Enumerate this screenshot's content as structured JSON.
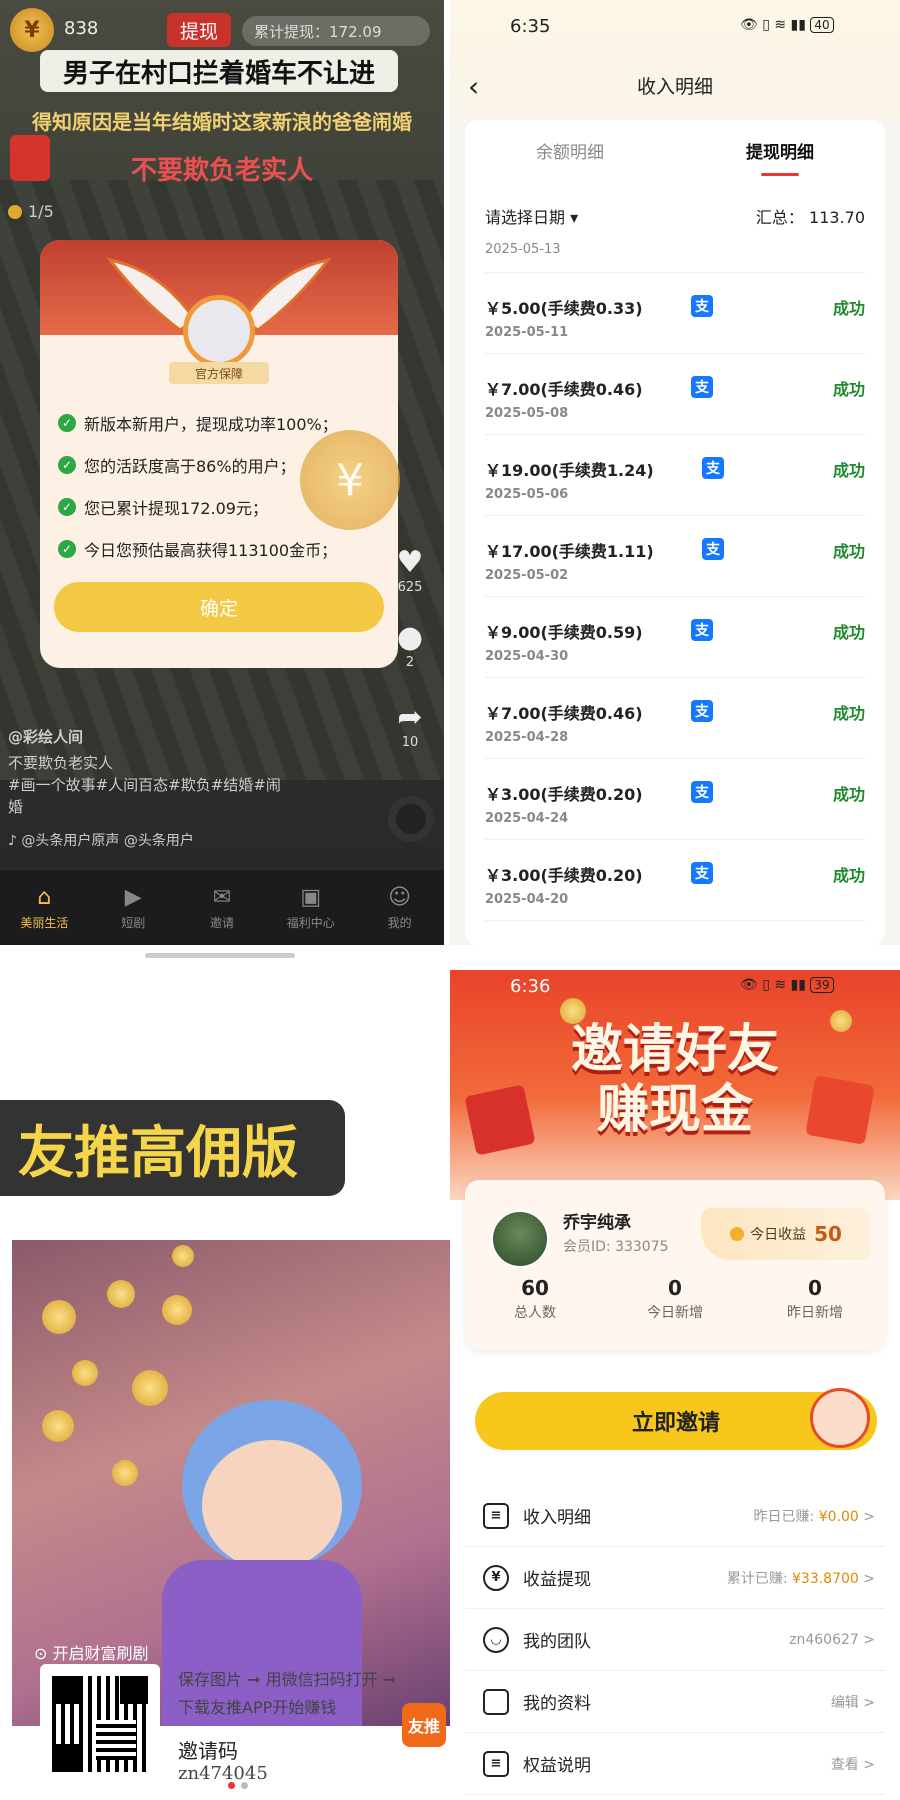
{
  "panel1": {
    "coin_count": "838",
    "withdraw_label": "提现",
    "total_withdraw": "累计提现：172.09",
    "video_title": "男子在村口拦着婚车不让进",
    "subtitle1": "得知原因是当年结婚时这家新浪的爸爸闹婚",
    "subtitle2": "不要欺负老实人",
    "counter": "1/5",
    "popup": {
      "badge": "官方保障",
      "lines": [
        "新版本新用户，提现成功率100%；",
        "您的活跃度高于86%的用户；",
        "您已累计提现172.09元；",
        "今日您预估最高获得113100金币；"
      ],
      "confirm": "确定"
    },
    "side": {
      "likes": "625",
      "comments": "2",
      "shares": "10"
    },
    "author": "@彩绘人间",
    "desc_line1": "不要欺负老实人",
    "desc_line2": "#画一个故事#人间百态#欺负#结婚#闹",
    "desc_line3": "婚",
    "music": "@头条用户原声   @头条用户",
    "tabs": [
      "美丽生活",
      "短剧",
      "邀请",
      "福利中心",
      "我的"
    ]
  },
  "panel2": {
    "time": "6:35",
    "battery": "40",
    "title": "收入明细",
    "tabs": [
      "余额明细",
      "提现明细"
    ],
    "date_picker": "请选择日期",
    "total": "汇总：  113.70",
    "first_date": "2025-05-13",
    "records": [
      {
        "amount": "￥5.00(手续费0.33)",
        "date": "2025-05-11",
        "status": "成功"
      },
      {
        "amount": "￥7.00(手续费0.46)",
        "date": "2025-05-08",
        "status": "成功"
      },
      {
        "amount": "￥19.00(手续费1.24)",
        "date": "2025-05-06",
        "status": "成功"
      },
      {
        "amount": "￥17.00(手续费1.11)",
        "date": "2025-05-02",
        "status": "成功"
      },
      {
        "amount": "￥9.00(手续费0.59)",
        "date": "2025-04-30",
        "status": "成功"
      },
      {
        "amount": "￥7.00(手续费0.46)",
        "date": "2025-04-28",
        "status": "成功"
      },
      {
        "amount": "￥3.00(手续费0.20)",
        "date": "2025-04-24",
        "status": "成功"
      },
      {
        "amount": "￥3.00(手续费0.20)",
        "date": "2025-04-20",
        "status": "成功"
      }
    ],
    "alipay_glyph": "支"
  },
  "panel3": {
    "title": "友推高佣版",
    "caption": "开启财富刷剧",
    "step1": "保存图片 ➞ 用微信扫码打开 ➞",
    "step2": "下载友推APP开始赚钱",
    "invite_label": "邀请码",
    "invite_code": "zn474045",
    "logo": "友推"
  },
  "panel4": {
    "time": "6:36",
    "battery": "39",
    "banner_line1": "邀请好友",
    "banner_line2": "赚现金",
    "user_name": "乔宇纯承",
    "member_id": "会员ID:  333075",
    "today_label": "今日收益",
    "today_value": "50",
    "stats": [
      {
        "n": "60",
        "l": "总人数"
      },
      {
        "n": "0",
        "l": "今日新增"
      },
      {
        "n": "0",
        "l": "昨日新增"
      }
    ],
    "invite_button": "立即邀请",
    "menu": [
      {
        "label": "收入明细",
        "prefix": "昨日已赚: ",
        "value": "¥0.00",
        "arrow": ">"
      },
      {
        "label": "收益提现",
        "prefix": "累计已赚: ",
        "value": "¥33.8700",
        "arrow": ">"
      },
      {
        "label": "我的团队",
        "prefix": "zn460627",
        "value": "",
        "arrow": ">"
      },
      {
        "label": "我的资料",
        "prefix": "编辑",
        "value": "",
        "arrow": ">"
      },
      {
        "label": "权益说明",
        "prefix": "查看",
        "value": "",
        "arrow": ">"
      }
    ]
  }
}
